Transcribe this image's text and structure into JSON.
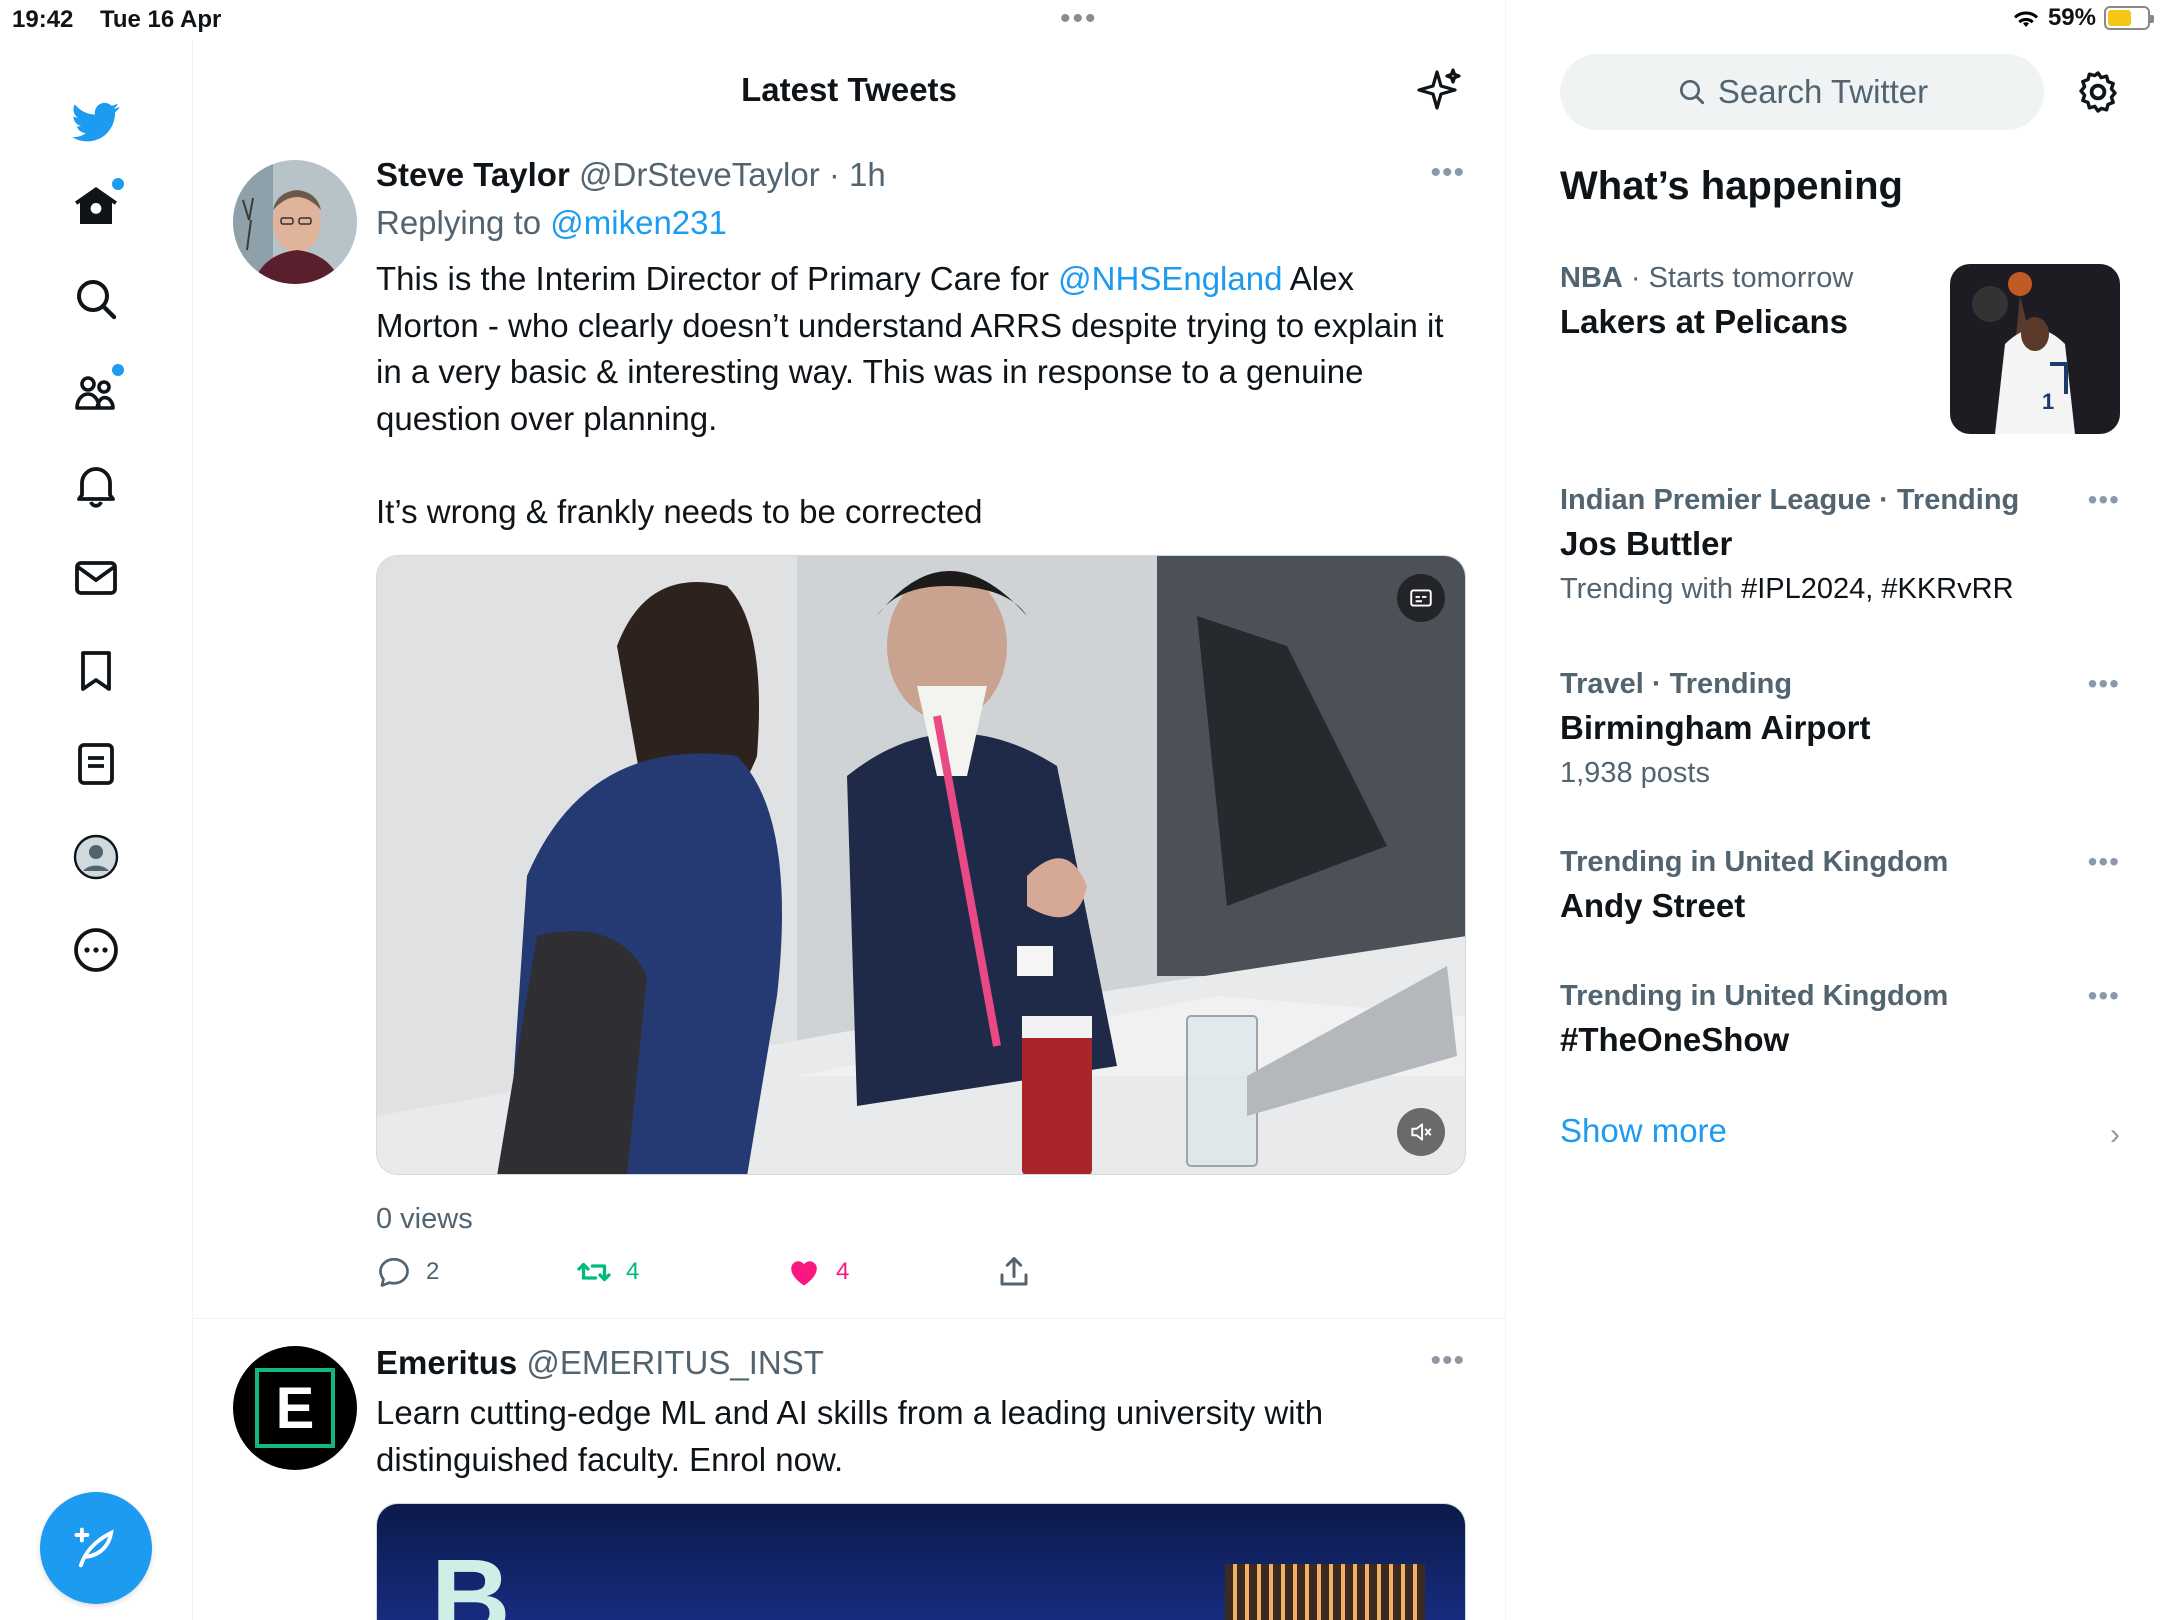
{
  "status_bar": {
    "time": "19:42",
    "date": "Tue 16 Apr",
    "battery": "59%",
    "battery_level": 0.59
  },
  "nav": {
    "items": [
      {
        "name": "home-icon",
        "has_dot": true
      },
      {
        "name": "search-icon",
        "has_dot": false
      },
      {
        "name": "communities-icon",
        "has_dot": true
      },
      {
        "name": "notifications-icon",
        "has_dot": false
      },
      {
        "name": "messages-icon",
        "has_dot": false
      },
      {
        "name": "bookmarks-icon",
        "has_dot": false
      },
      {
        "name": "lists-icon",
        "has_dot": false
      },
      {
        "name": "profile-icon",
        "has_dot": false
      },
      {
        "name": "more-icon",
        "has_dot": false
      }
    ],
    "accent": "#1d9bf0"
  },
  "header": {
    "title": "Latest Tweets"
  },
  "tweets": [
    {
      "name": "Steve Taylor",
      "handle": "@DrSteveTaylor",
      "time": "· 1h",
      "replying_prefix": "Replying to ",
      "replying_to": "@miken231",
      "text_before_link": "This is the Interim Director of Primary Care for ",
      "text_link": "@NHSEngland",
      "text_after_link": " Alex Morton - who clearly doesn’t understand ARRS despite trying to explain it in a very basic & interesting way. This was in response to a genuine question over planning.\n\nIt’s wrong & frankly needs to be corrected",
      "views": "0 views",
      "replies": "2",
      "retweets": "4",
      "likes": "4",
      "retweet_color": "#00ba7c",
      "like_color": "#f91880"
    },
    {
      "name": "Emeritus",
      "handle": "@EMERITUS_INST",
      "text": "Learn cutting-edge ML and AI skills from a leading university with distinguished faculty. Enrol now.",
      "avatar_letter": "E",
      "media_letter": "B"
    }
  ],
  "right": {
    "search_placeholder": "Search Twitter",
    "whats_happening": "What’s happening",
    "trends": [
      {
        "context_bold": "NBA",
        "context": " · Starts tomorrow",
        "title": "Lakers at Pelicans",
        "sub": ""
      },
      {
        "context_bold": "Indian Premier League · Trending",
        "context": "",
        "title": "Jos Buttler",
        "sub_prefix": "Trending with ",
        "sub_tags": "#IPL2024, #KKRvRR"
      },
      {
        "context_bold": "Travel · Trending",
        "context": "",
        "title": "Birmingham Airport",
        "sub": "1,938 posts"
      },
      {
        "context_bold": "Trending in United Kingdom",
        "context": "",
        "title": "Andy Street",
        "sub": ""
      },
      {
        "context_bold": "Trending in United Kingdom",
        "context": "",
        "title": "#TheOneShow",
        "sub": ""
      }
    ],
    "show_more": "Show more"
  }
}
